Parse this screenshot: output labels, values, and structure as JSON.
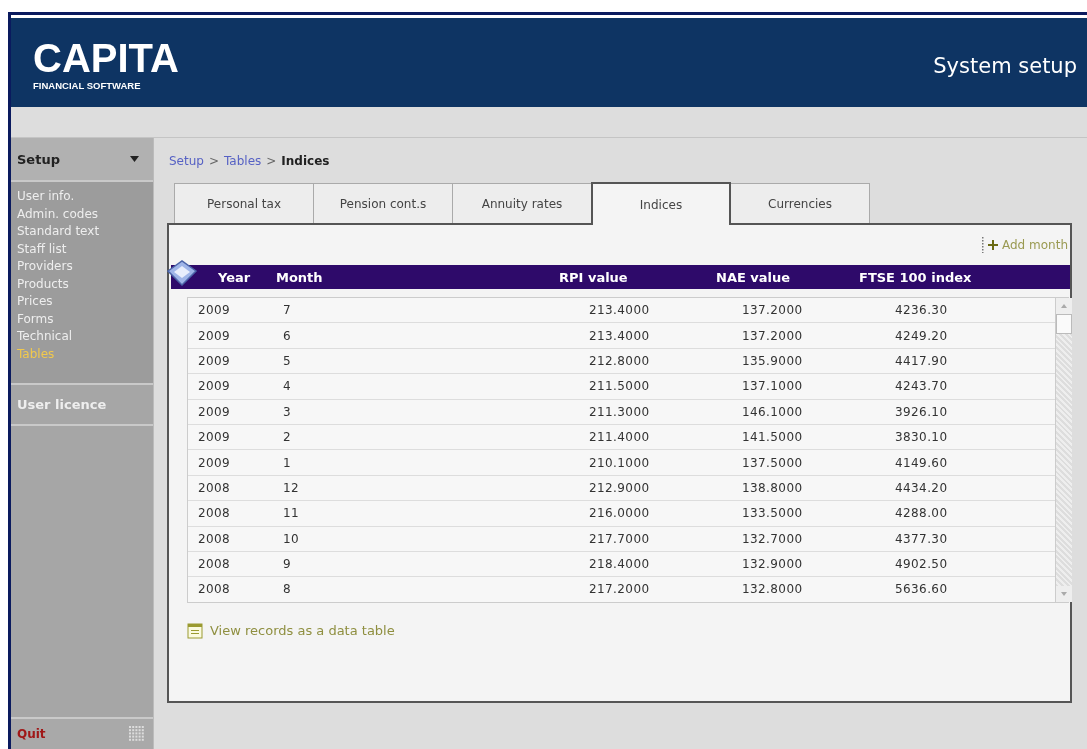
{
  "header": {
    "logo": "CAPITA",
    "logo_subtitle": "FINANCIAL SOFTWARE",
    "title": "System setup"
  },
  "sidebar": {
    "section": "Setup",
    "items": [
      {
        "label": "User info.",
        "selected": false
      },
      {
        "label": "Admin. codes",
        "selected": false
      },
      {
        "label": "Standard text",
        "selected": false
      },
      {
        "label": "Staff list",
        "selected": false
      },
      {
        "label": "Providers",
        "selected": false
      },
      {
        "label": "Products",
        "selected": false
      },
      {
        "label": "Prices",
        "selected": false
      },
      {
        "label": "Forms",
        "selected": false
      },
      {
        "label": "Technical",
        "selected": false
      },
      {
        "label": "Tables",
        "selected": true
      }
    ],
    "section_2": "User licence",
    "quit": "Quit"
  },
  "breadcrumb": {
    "links": [
      "Setup",
      "Tables"
    ],
    "separators": [
      ">",
      ">"
    ],
    "current": "Indices"
  },
  "tabs": [
    {
      "label": "Personal tax",
      "selected": false
    },
    {
      "label": "Pension cont.s",
      "selected": false
    },
    {
      "label": "Annuity rates",
      "selected": false
    },
    {
      "label": "Indices",
      "selected": true
    },
    {
      "label": "Currencies",
      "selected": false
    }
  ],
  "add_button": "Add month",
  "table": {
    "columns": [
      "Year",
      "Month",
      "RPI value",
      "NAE value",
      "FTSE 100 index"
    ],
    "rows": [
      [
        "2009",
        "7",
        "213.4000",
        "137.2000",
        "4236.30"
      ],
      [
        "2009",
        "6",
        "213.4000",
        "137.2000",
        "4249.20"
      ],
      [
        "2009",
        "5",
        "212.8000",
        "135.9000",
        "4417.90"
      ],
      [
        "2009",
        "4",
        "211.5000",
        "137.1000",
        "4243.70"
      ],
      [
        "2009",
        "3",
        "211.3000",
        "146.1000",
        "3926.10"
      ],
      [
        "2009",
        "2",
        "211.4000",
        "141.5000",
        "3830.10"
      ],
      [
        "2009",
        "1",
        "210.1000",
        "137.5000",
        "4149.60"
      ],
      [
        "2008",
        "12",
        "212.9000",
        "138.8000",
        "4434.20"
      ],
      [
        "2008",
        "11",
        "216.0000",
        "133.5000",
        "4288.00"
      ],
      [
        "2008",
        "10",
        "217.7000",
        "132.7000",
        "4377.30"
      ],
      [
        "2008",
        "9",
        "218.4000",
        "132.9000",
        "4902.50"
      ],
      [
        "2008",
        "8",
        "217.2000",
        "132.8000",
        "5636.60"
      ]
    ]
  },
  "view_link": "View records as a data table"
}
